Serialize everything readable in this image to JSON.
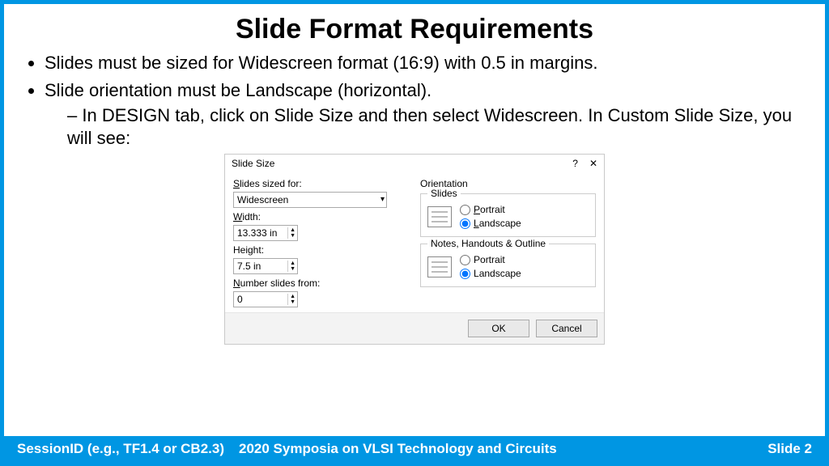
{
  "title": "Slide Format Requirements",
  "bullets": {
    "b1": "Slides must be sized for Widescreen format (16:9) with 0.5 in margins.",
    "b2": "Slide orientation must be Landscape (horizontal).",
    "b2a": "In DESIGN tab, click on Slide Size and then select Widescreen.  In Custom Slide Size, you will see:"
  },
  "dialog": {
    "caption": "Slide Size",
    "help": "?",
    "close": "✕",
    "left": {
      "sized_label_pre": "S",
      "sized_label_post": "lides sized for:",
      "sized_value": "Widescreen",
      "width_label_pre": "W",
      "width_label_post": "idth:",
      "width_value": "13.333 in",
      "height_label": "H",
      "height_label_post": "eight:",
      "height_value": "7.5 in",
      "number_label_pre": "N",
      "number_label_post": "umber slides from:",
      "number_value": "0"
    },
    "right": {
      "orientation": "Orientation",
      "slides_group": "Slides",
      "notes_group": "Notes, Handouts & Outline",
      "portrait_pre": "P",
      "portrait_post": "ortrait",
      "landscape_pre": "L",
      "landscape_post": "andscape"
    },
    "ok": "OK",
    "cancel": "Cancel"
  },
  "footer": {
    "session": "SessionID (e.g., TF1.4 or CB2.3)",
    "conference": "2020 Symposia on VLSI Technology and Circuits",
    "page": "Slide 2"
  }
}
